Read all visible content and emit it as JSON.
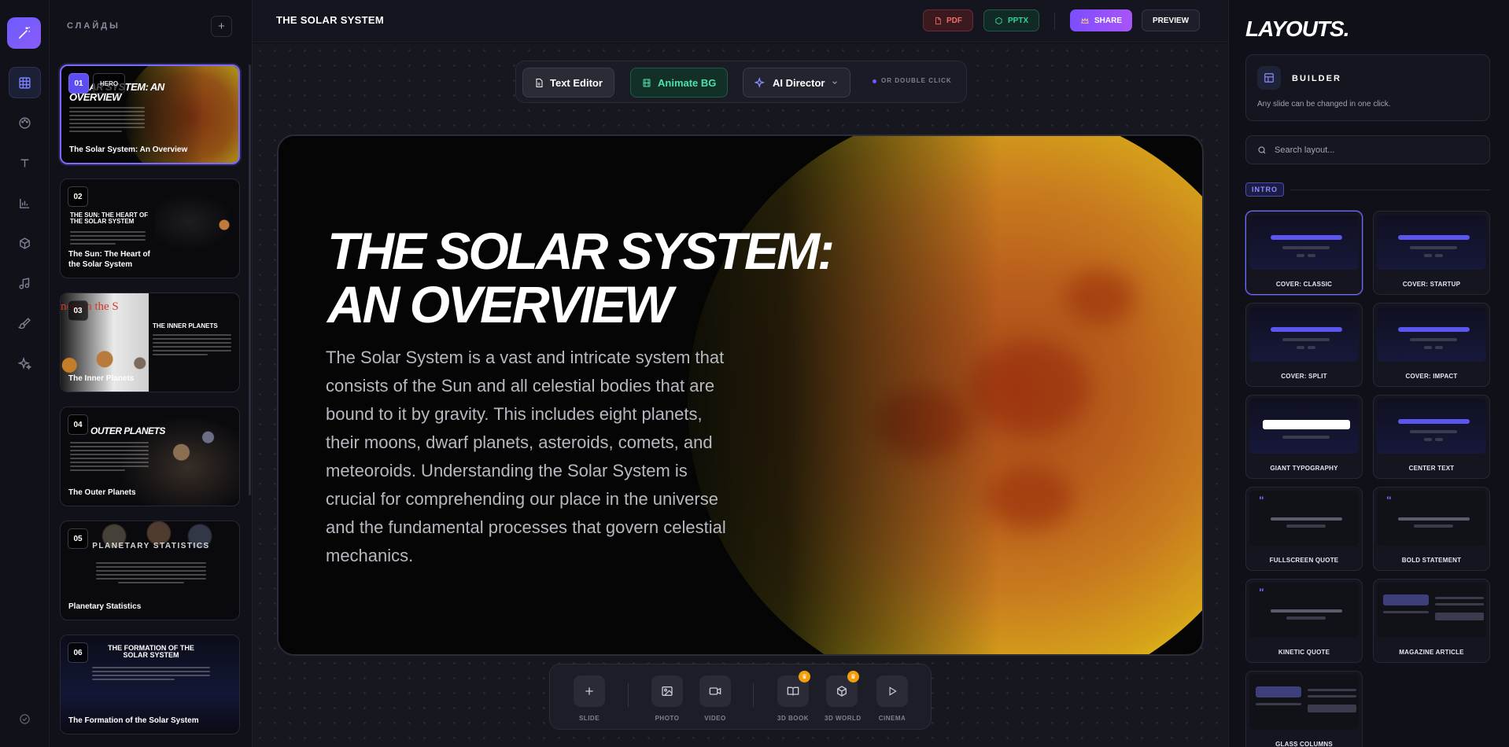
{
  "app": {
    "slides_header": "СЛАЙДЫ",
    "presentation_title": "THE SOLAR SYSTEM"
  },
  "topbar": {
    "pdf": "PDF",
    "pptx": "PPTX",
    "share": "SHARE",
    "preview": "PREVIEW"
  },
  "toolbar": {
    "text_editor": "Text Editor",
    "animate_bg": "Animate BG",
    "ai_director": "AI Director",
    "hint": "OR DOUBLE CLICK"
  },
  "slides": [
    {
      "num": "01",
      "badge": "HERO",
      "mini": "SOLAR SYSTEM: AN OVERVIEW",
      "caption": "The Solar System: An Overview"
    },
    {
      "num": "02",
      "mini": "THE SUN: THE HEART OF THE SOLAR SYSTEM",
      "caption": "The Sun: The Heart of the Solar System"
    },
    {
      "num": "03",
      "mini": "THE INNER PLANETS",
      "overlay": "nets in the S",
      "caption": "The Inner Planets"
    },
    {
      "num": "04",
      "mini": "OUTER PLANETS",
      "caption": "The Outer Planets"
    },
    {
      "num": "05",
      "mini": "PLANETARY STATISTICS",
      "caption": "Planetary Statistics"
    },
    {
      "num": "06",
      "mini": "THE FORMATION OF THE SOLAR SYSTEM",
      "caption": "The Formation of the Solar System"
    }
  ],
  "slide": {
    "title": "THE SOLAR SYSTEM: AN OVERVIEW",
    "body": "The Solar System is a vast and intricate system that consists of the Sun and all celestial bodies that are bound to it by gravity. This includes eight planets, their moons, dwarf planets, asteroids, comets, and meteoroids. Understanding the Solar System is crucial for comprehending our place in the universe and the fundamental processes that govern celestial mechanics."
  },
  "dock": {
    "slide": "SLIDE",
    "photo": "PHOTO",
    "video": "VIDEO",
    "book3d": "3D BOOK",
    "world3d": "3D WORLD",
    "cinema": "CINEMA"
  },
  "layouts": {
    "title": "LAYOUTS.",
    "builder_title": "BUILDER",
    "builder_desc": "Any slide can be changed in one click.",
    "search_placeholder": "Search layout...",
    "section": "INTRO",
    "items": [
      "COVER: CLASSIC",
      "COVER: STARTUP",
      "COVER: SPLIT",
      "COVER: IMPACT",
      "GIANT TYPOGRAPHY",
      "CENTER TEXT",
      "FULLSCREEN QUOTE",
      "BOLD STATEMENT",
      "KINETIC QUOTE",
      "MAGAZINE ARTICLE",
      "GLASS COLUMNS"
    ]
  },
  "colors": {
    "accent": "#6b5cff",
    "pdf_red": "#f26b6b",
    "pptx_green": "#34d399",
    "share_purple": "#8b5cf6"
  }
}
